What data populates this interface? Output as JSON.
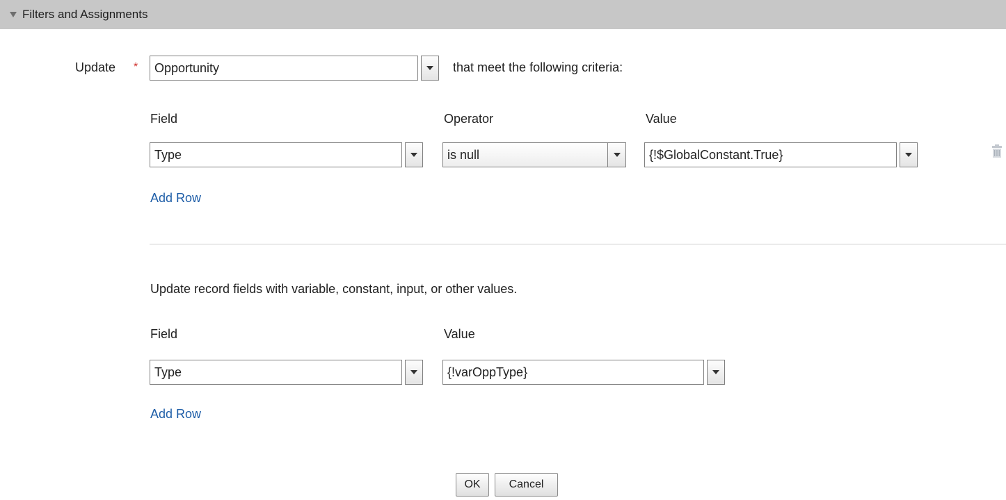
{
  "section": {
    "title": "Filters and Assignments"
  },
  "update": {
    "label": "Update",
    "required_mark": "*",
    "object_value": "Opportunity",
    "criteria_text": "that meet the following criteria:"
  },
  "filters": {
    "headers": {
      "field": "Field",
      "operator": "Operator",
      "value": "Value"
    },
    "rows": [
      {
        "field": "Type",
        "operator": "is null",
        "value": "{!$GlobalConstant.True}"
      }
    ],
    "add_row": "Add Row"
  },
  "assignments": {
    "description": "Update record fields with variable, constant, input, or other values.",
    "headers": {
      "field": "Field",
      "value": "Value"
    },
    "rows": [
      {
        "field": "Type",
        "value": "{!varOppType}"
      }
    ],
    "add_row": "Add Row"
  },
  "buttons": {
    "ok": "OK",
    "cancel": "Cancel"
  },
  "icons": {
    "section_toggle": "triangle-down-icon",
    "delete_row": "trash-icon"
  },
  "colors": {
    "header_bg": "#c7c7c7",
    "link": "#1f5ea8",
    "required": "#d0332f"
  }
}
